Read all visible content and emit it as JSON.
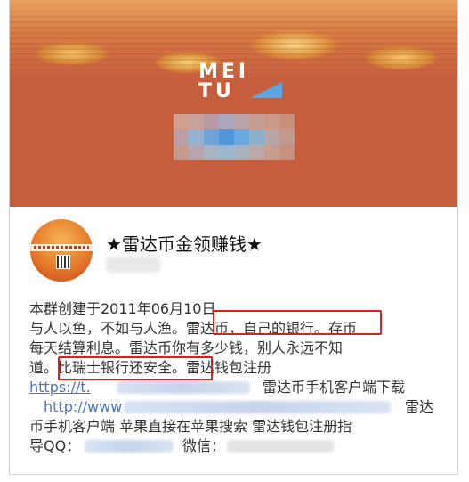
{
  "banner": {
    "logo_top": "MEI",
    "logo_bottom": "TU",
    "bg_color": "#c65e3e"
  },
  "group": {
    "title": "★雷达币金领赚钱★",
    "avatar_icon": "coins-avatar"
  },
  "description": {
    "line1": "本群创建于2011年06月10日",
    "line2a": "与人以鱼，不如与人渔。",
    "line2b": "雷达币，自己的银行。",
    "line2c": "存币",
    "line3": "每天结算利息。雷达币你有多少钱，别人永远不知",
    "line4a": "道。",
    "line4b": "比瑞士银行还安全。",
    "line4c": "雷达钱包注册",
    "line5_link": "https://t.",
    "line5_text": "雷达币手机客户端下载",
    "line6_link": "http://www",
    "line6_text": "雷达",
    "line7": "币手机客户端 苹果直接在苹果搜索 雷达钱包注册指",
    "line8a": "导QQ：",
    "line8b": "微信："
  },
  "colors": {
    "highlight": "#e11e1e",
    "link": "#4a74c0"
  }
}
